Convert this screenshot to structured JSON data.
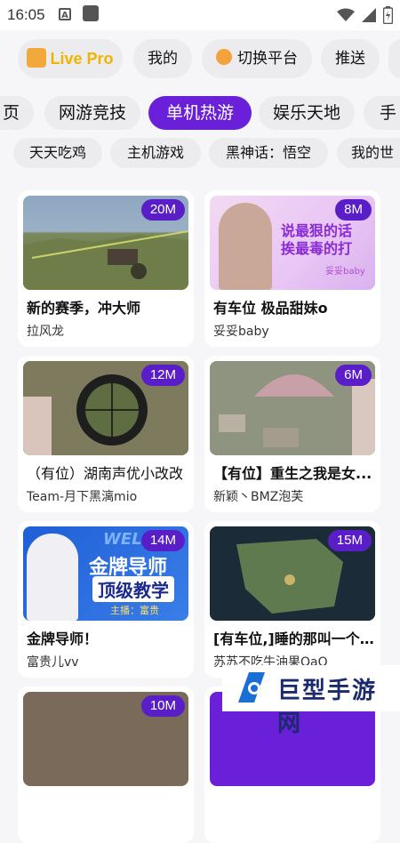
{
  "status": {
    "time": "16:05",
    "a_icon": "A"
  },
  "top_nav": {
    "live_pro": "Live Pro",
    "mine": "我的",
    "switch_platform": "切换平台",
    "push": "推送"
  },
  "categories": [
    "页",
    "网游竞技",
    "单机热游",
    "娱乐天地",
    "手"
  ],
  "active_category": "单机热游",
  "subcategories": [
    "天天吃鸡",
    "主机游戏",
    "黑神话：悟空",
    "我的世"
  ],
  "cards": [
    {
      "title": "新的赛季，冲大师",
      "author": "拉风龙",
      "viewers": "20M"
    },
    {
      "title": "有车位 极品甜妹o",
      "author": "妥妥baby",
      "viewers": "8M",
      "thumb_text": "说最狠的话 挨最毒的打",
      "thumb_sub": "妥妥baby"
    },
    {
      "title": "（有位）湖南声优小改改",
      "author": "Team-月下黑漓mio",
      "viewers": "12M"
    },
    {
      "title": "【有位】重生之我是女...",
      "author": "新颖丶BMZ泡芙",
      "viewers": "6M"
    },
    {
      "title": "金牌导师！",
      "author": "富贵儿vv",
      "viewers": "14M",
      "thumb_text": "金牌导师",
      "thumb_text2": "顶级教学",
      "thumb_sub": "主播：富贵",
      "thumb_welc": "WELC"
    },
    {
      "title": "[有车位,]睡的那叫一个...",
      "author": "苏苏不吃牛油果QaQ",
      "viewers": "15M"
    },
    {
      "viewers": "10M"
    }
  ],
  "watermark": "巨型手游网",
  "colors": {
    "accent": "#6a1fd9",
    "badge": "#5a1ec8"
  }
}
